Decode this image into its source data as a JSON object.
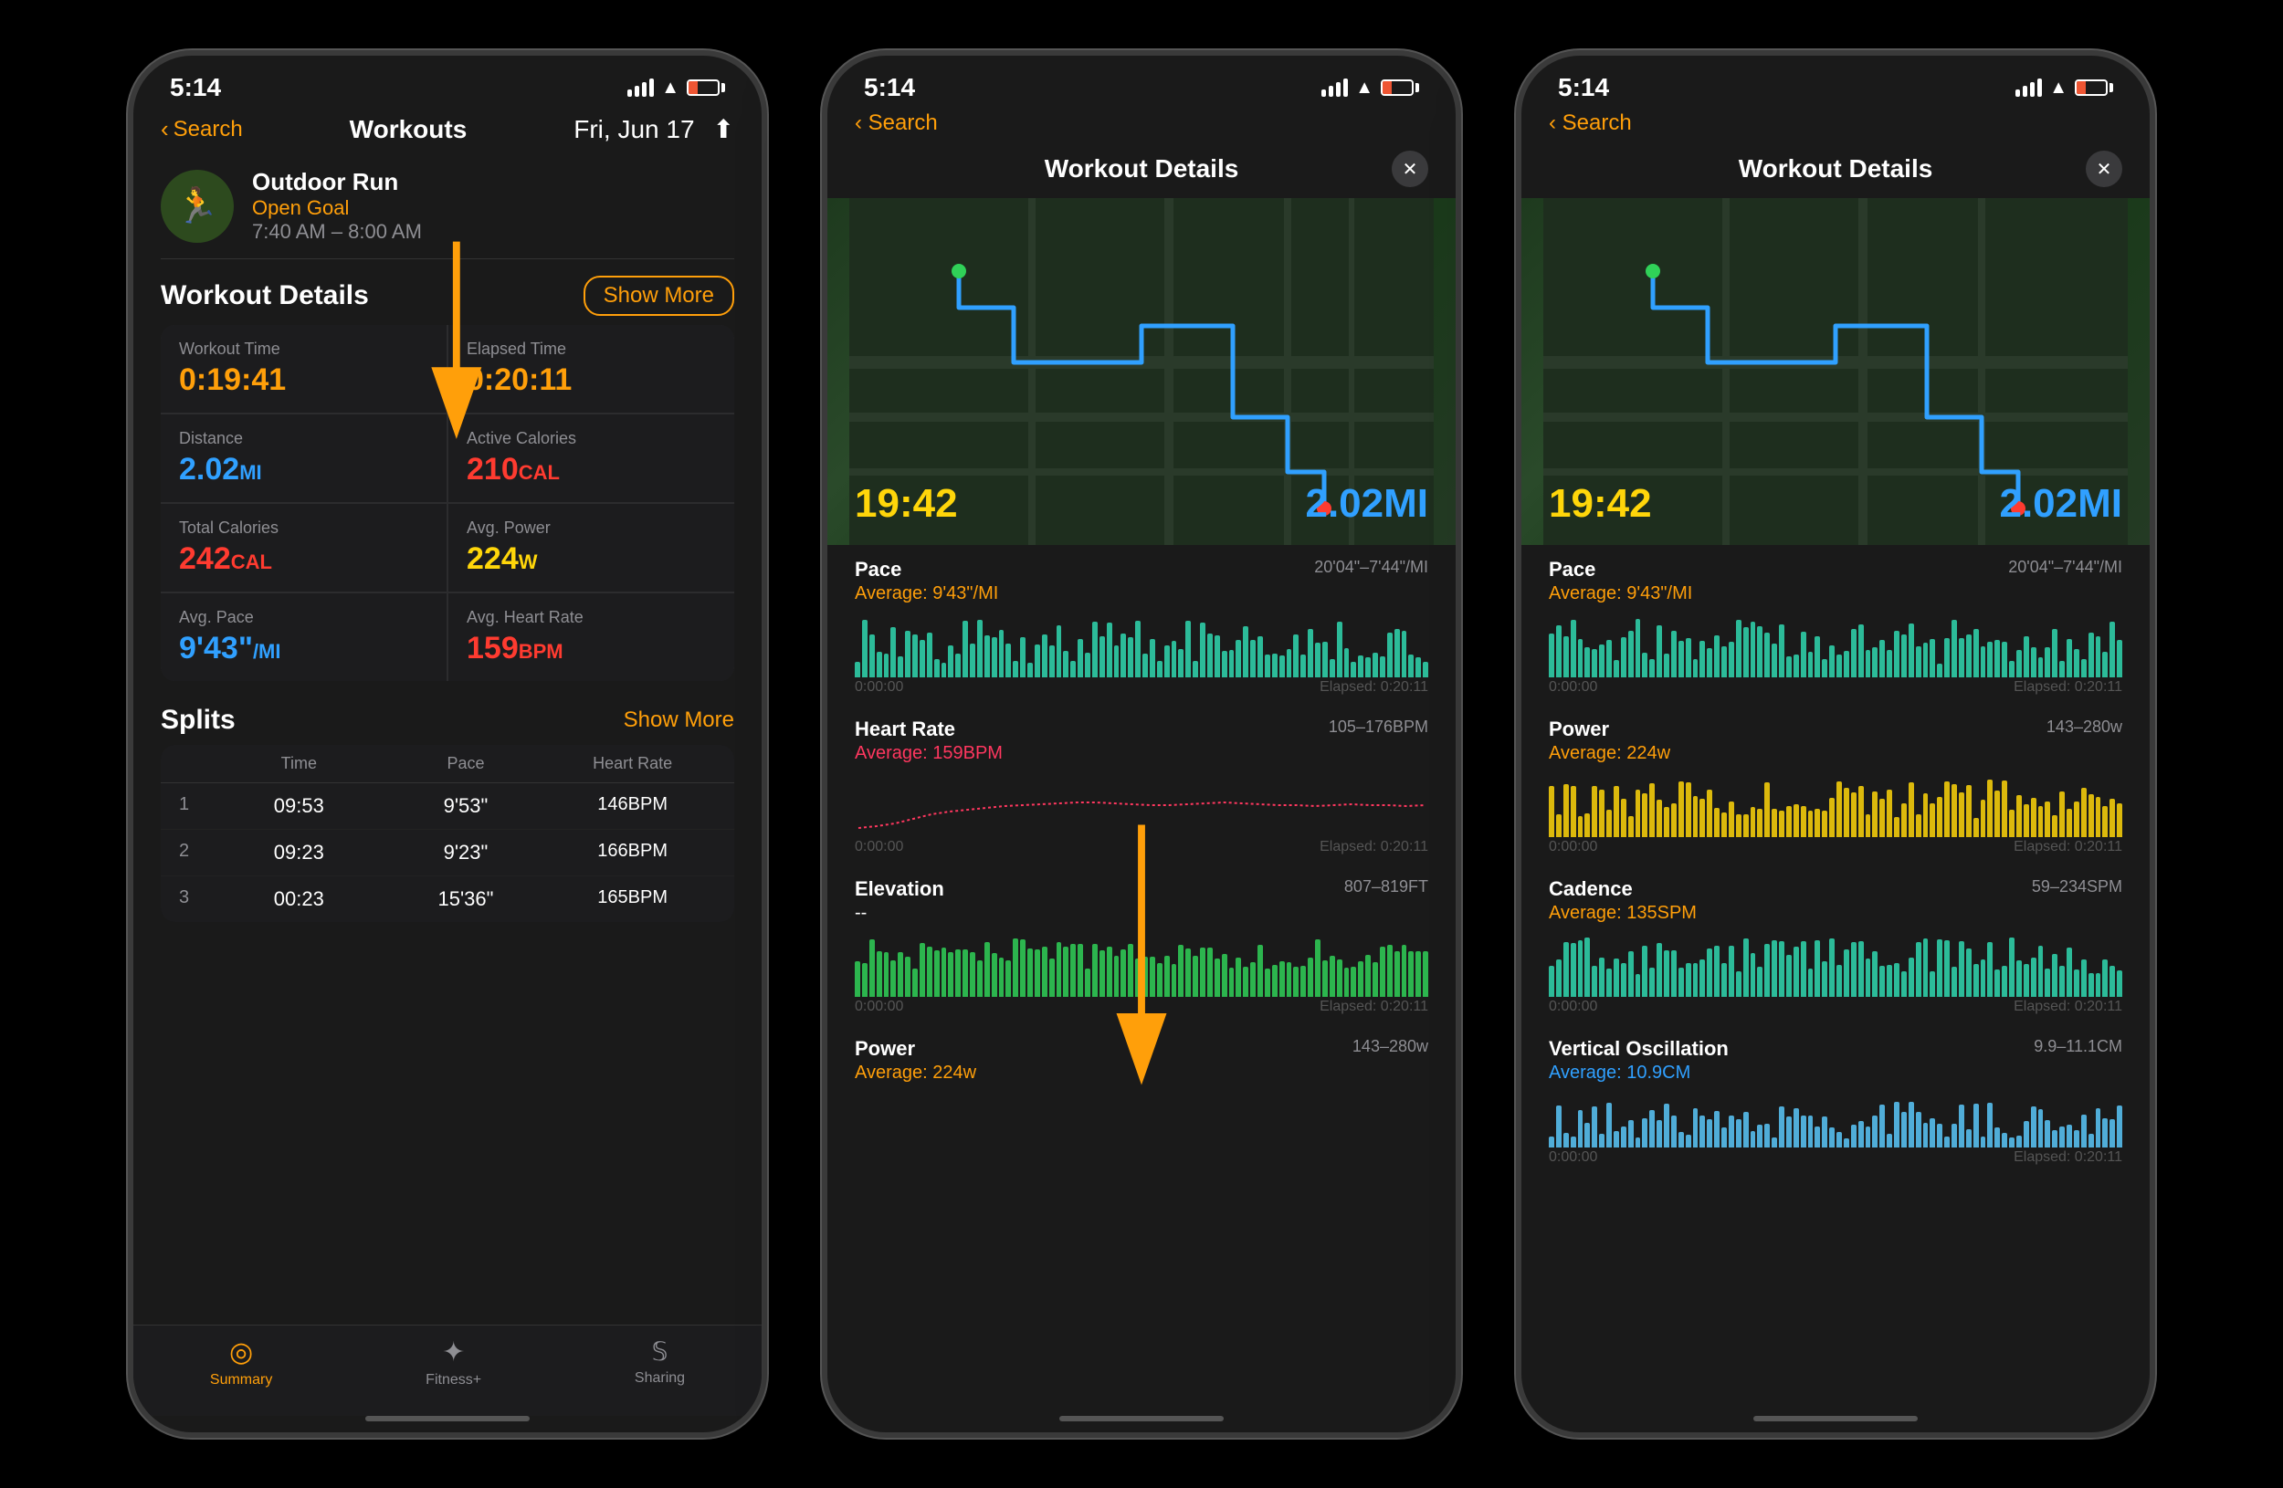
{
  "phones": [
    {
      "id": "phone1",
      "statusBar": {
        "time": "5:14",
        "back": "Search",
        "navTitle": "",
        "rightAction": "share"
      },
      "workout": {
        "icon": "🏃",
        "name": "Outdoor Run",
        "goal": "Open Goal",
        "timeRange": "7:40 AM – 8:00 AM"
      },
      "workoutDetails": {
        "sectionTitle": "Workout Details",
        "showMoreLabel": "Show More",
        "stats": [
          {
            "label": "Workout Time",
            "value": "0:19:41",
            "color": "orange"
          },
          {
            "label": "Elapsed Time",
            "value": "0:20:11",
            "color": "orange"
          },
          {
            "label": "Distance",
            "value": "2.02",
            "unit": "MI",
            "color": "blue"
          },
          {
            "label": "Active Calories",
            "value": "210",
            "unit": "CAL",
            "color": "red"
          },
          {
            "label": "Total Calories",
            "value": "242",
            "unit": "CAL",
            "color": "red"
          },
          {
            "label": "Avg. Power",
            "value": "224",
            "unit": "W",
            "color": "yellow"
          },
          {
            "label": "Avg. Pace",
            "value": "9'43\"",
            "unit": "/MI",
            "color": "blue"
          },
          {
            "label": "Avg. Heart Rate",
            "value": "159",
            "unit": "BPM",
            "color": "red"
          }
        ]
      },
      "splits": {
        "sectionTitle": "Splits",
        "showMoreLabel": "Show More",
        "headers": [
          "",
          "Time",
          "Pace",
          "Heart Rate"
        ],
        "rows": [
          {
            "num": "1",
            "time": "09:53",
            "pace": "9'53\"",
            "hr": "146BPM",
            "hrColor": "orange"
          },
          {
            "num": "2",
            "time": "09:23",
            "pace": "9'23\"",
            "hr": "166BPM",
            "hrColor": "red"
          },
          {
            "num": "3",
            "time": "00:23",
            "pace": "15'36\"",
            "hr": "165BPM",
            "hrColor": "red"
          }
        ]
      },
      "tabBar": {
        "tabs": [
          {
            "icon": "◎",
            "label": "Summary",
            "active": true
          },
          {
            "icon": "✦",
            "label": "Fitness+",
            "active": false
          },
          {
            "icon": "𝕊",
            "label": "Sharing",
            "active": false
          }
        ]
      }
    },
    {
      "id": "phone2",
      "statusBar": {
        "time": "5:14"
      },
      "modal": {
        "title": "Workout Details",
        "map": {
          "time": "19:42",
          "distance": "2.02MI"
        },
        "charts": [
          {
            "label": "Pace",
            "avg": "Average: 9'43\"/MI",
            "avgColor": "orange",
            "range": "20'04\"–7'44\"/MI",
            "footer": [
              "0:00:00",
              "Elapsed: 0:20:11"
            ],
            "type": "bar",
            "color": "#30d8b0"
          },
          {
            "label": "Heart Rate",
            "avg": "Average: 159BPM",
            "avgColor": "red",
            "range": "105–176BPM",
            "footer": [
              "0:00:00",
              "Elapsed: 0:20:11"
            ],
            "type": "heartrate",
            "color": "#ff375f"
          },
          {
            "label": "Elevation",
            "avg": "--",
            "avgColor": "white",
            "range": "807–819FT",
            "footer": [
              "0:00:00",
              "Elapsed: 0:20:11"
            ],
            "type": "bar",
            "color": "#30d158"
          },
          {
            "label": "Power",
            "avg": "Average: 224w",
            "avgColor": "orange",
            "range": "143–280w",
            "footer": [
              "0:00:00",
              "Elapsed: 0:20:11"
            ],
            "type": "bar",
            "color": "#ffd60a"
          }
        ]
      }
    },
    {
      "id": "phone3",
      "statusBar": {
        "time": "5:14"
      },
      "modal": {
        "title": "Workout Details",
        "map": {
          "time": "19:42",
          "distance": "2.02MI"
        },
        "charts": [
          {
            "label": "Pace",
            "avg": "Average: 9'43\"/MI",
            "avgColor": "orange",
            "range": "20'04\"–7'44\"/MI",
            "footer": [
              "0:00:00",
              "Elapsed: 0:20:11"
            ],
            "type": "bar",
            "color": "#30d8b0"
          },
          {
            "label": "Power",
            "avg": "Average: 224w",
            "avgColor": "orange",
            "range": "143–280w",
            "footer": [
              "0:00:00",
              "Elapsed: 0:20:11"
            ],
            "type": "bar",
            "color": "#ffd60a"
          },
          {
            "label": "Cadence",
            "avg": "Average: 135SPM",
            "avgColor": "orange",
            "range": "59–234SPM",
            "footer": [
              "0:00:00",
              "Elapsed: 0:20:11"
            ],
            "type": "bar",
            "color": "#30d8b0"
          },
          {
            "label": "Vertical Oscillation",
            "avg": "Average: 10.9CM",
            "avgColor": "blue",
            "range": "9.9–11.1CM",
            "footer": [
              "0:00:00",
              "Elapsed: 0:20:11"
            ],
            "type": "bar",
            "color": "#5ac8fa"
          }
        ]
      }
    }
  ],
  "arrows": {
    "phone1": {
      "label": "Show More",
      "buttonLabel": "Show More"
    }
  }
}
